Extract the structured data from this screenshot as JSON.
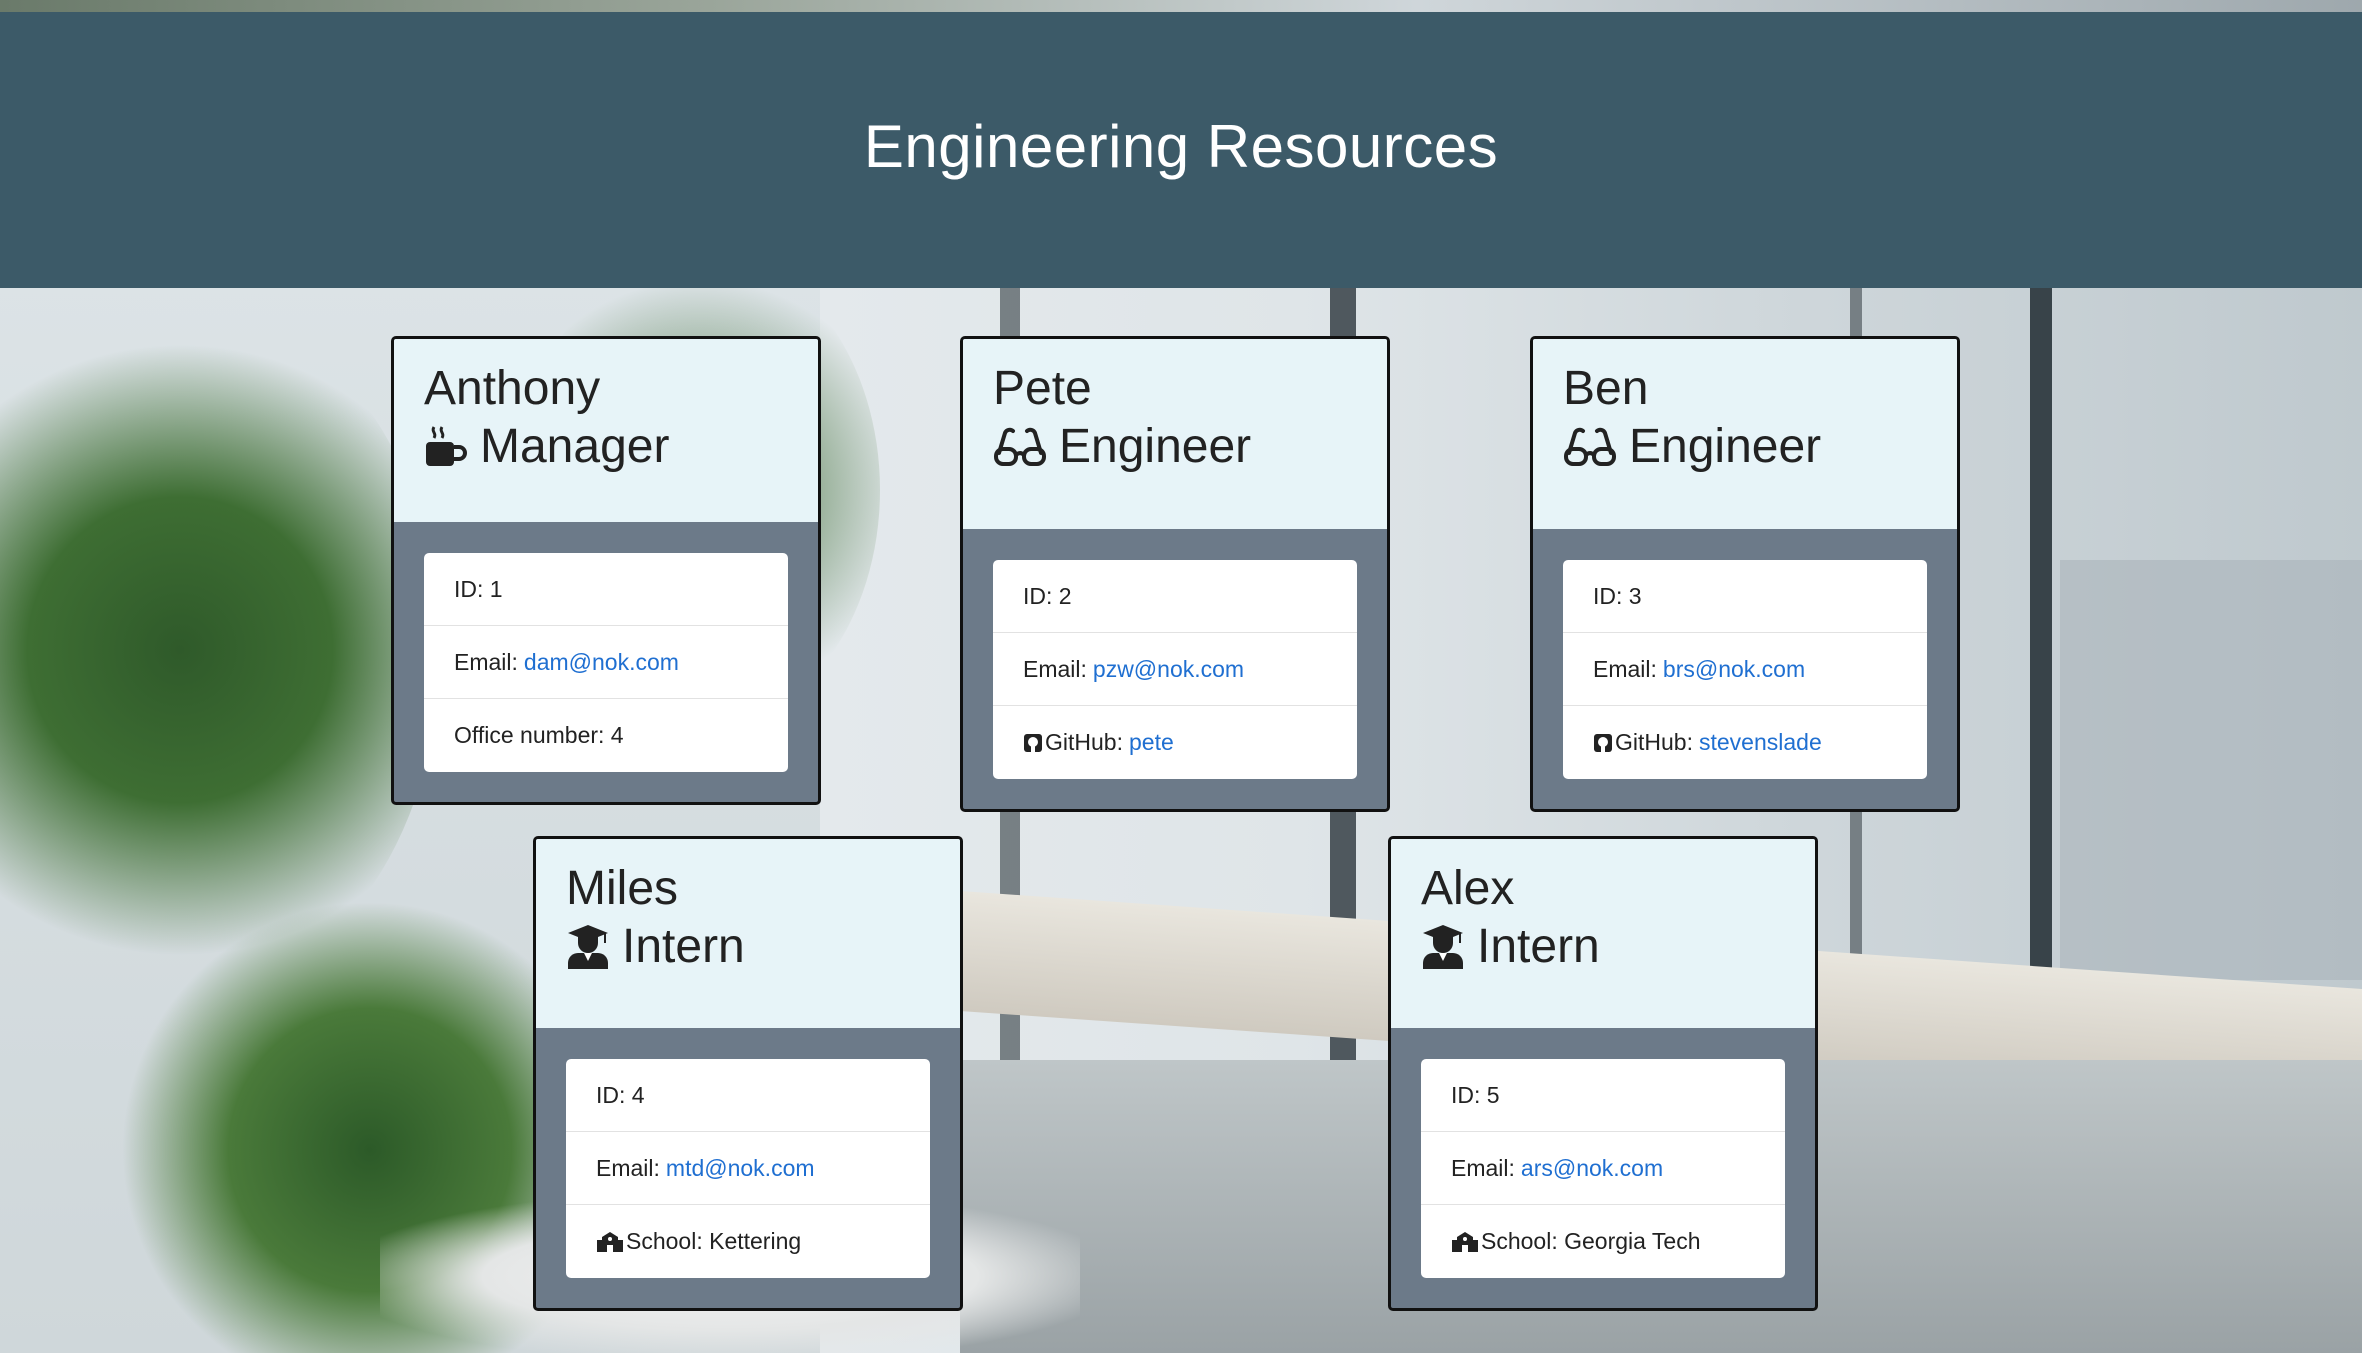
{
  "header": {
    "title": "Engineering Resources"
  },
  "employees": [
    {
      "name": "Anthony",
      "role": "Manager",
      "icon": "coffee-icon",
      "id_label": "ID: 1",
      "email_label": "Email:",
      "email": "dam@nok.com",
      "extra_label": "Office number: 4",
      "extra_link": ""
    },
    {
      "name": "Pete",
      "role": "Engineer",
      "icon": "glasses-icon",
      "id_label": "ID: 2",
      "email_label": "Email:",
      "email": "pzw@nok.com",
      "extra_label": "GitHub:",
      "extra_link": "pete",
      "extra_icon": "github-icon"
    },
    {
      "name": "Ben",
      "role": "Engineer",
      "icon": "glasses-icon",
      "id_label": "ID: 3",
      "email_label": "Email:",
      "email": "brs@nok.com",
      "extra_label": "GitHub:",
      "extra_link": "stevenslade",
      "extra_icon": "github-icon"
    },
    {
      "name": "Miles",
      "role": "Intern",
      "icon": "graduate-icon",
      "id_label": "ID: 4",
      "email_label": "Email:",
      "email": "mtd@nok.com",
      "extra_label": "School: Kettering",
      "extra_icon": "school-icon"
    },
    {
      "name": "Alex",
      "role": "Intern",
      "icon": "graduate-icon",
      "id_label": "ID: 5",
      "email_label": "Email:",
      "email": "ars@nok.com",
      "extra_label": "School: Georgia Tech",
      "extra_icon": "school-icon"
    }
  ],
  "colors": {
    "header_bg": "#3c5a68",
    "card_head_bg": "#e7f4f8",
    "card_body_bg": "#6c7a89",
    "link": "#1f6fd1"
  }
}
